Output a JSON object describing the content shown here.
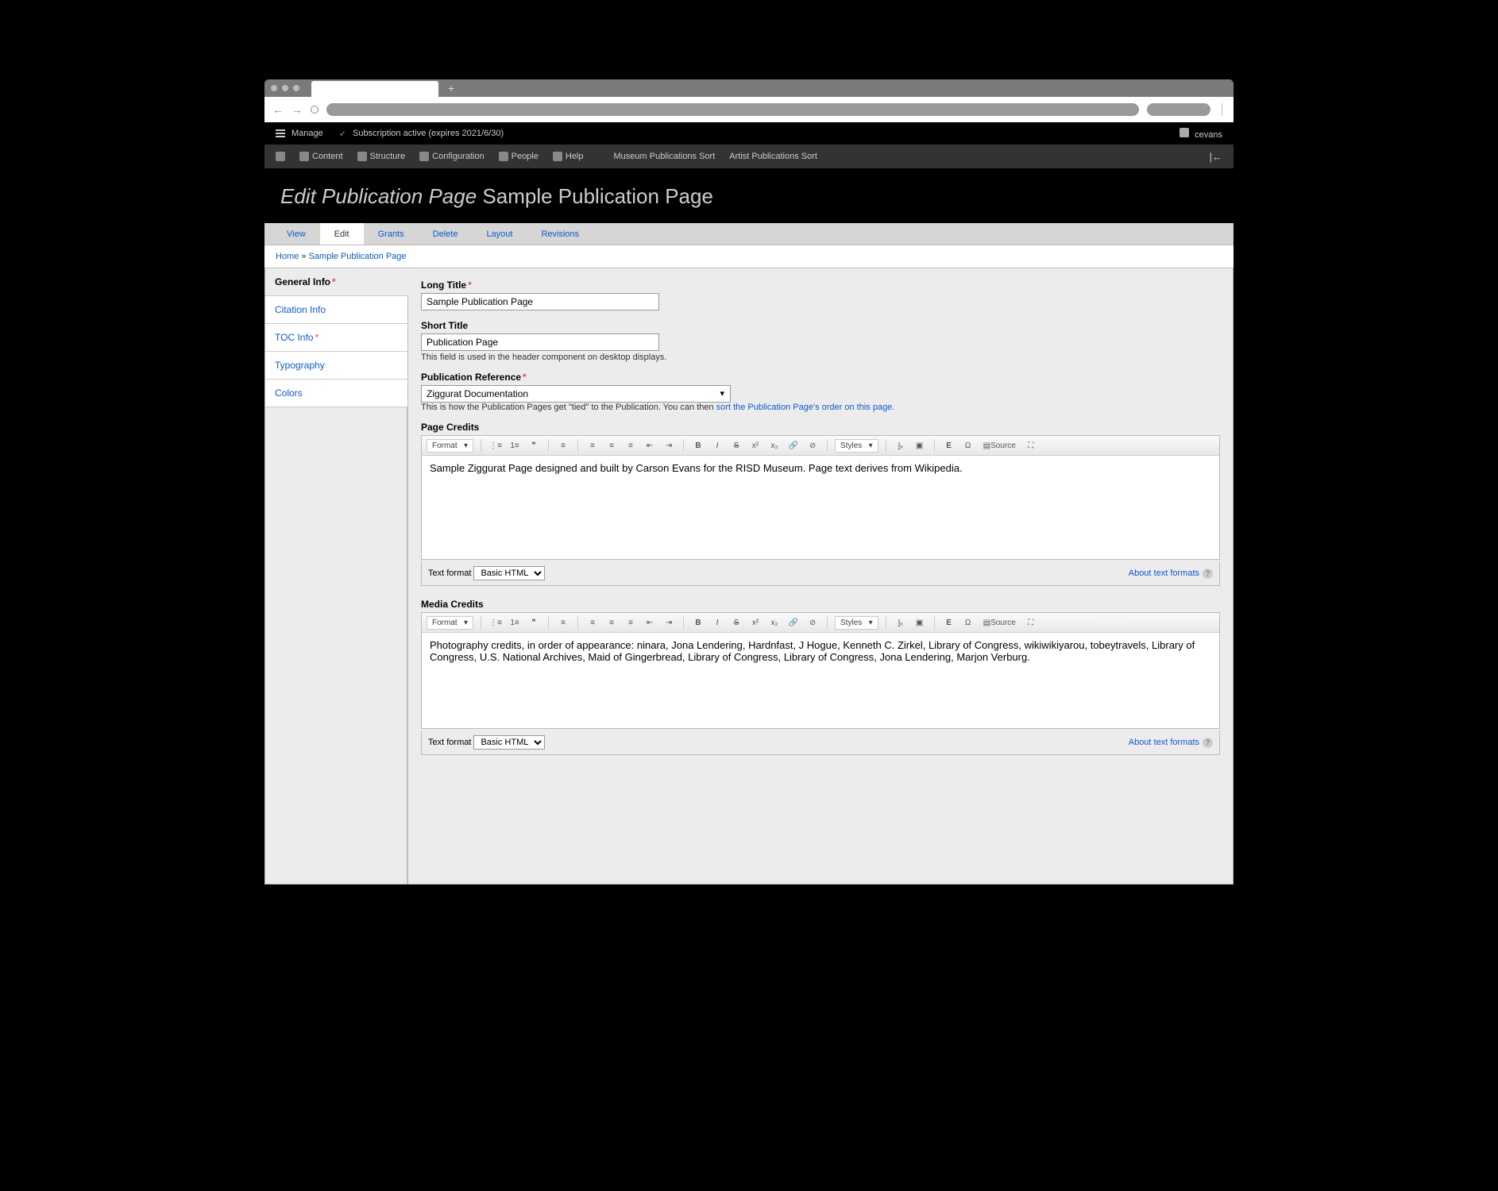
{
  "adminBar1": {
    "manage": "Manage",
    "subscription": "Subscription active (expires 2021/6/30)",
    "user": "cevans"
  },
  "adminBar2": {
    "content": "Content",
    "structure": "Structure",
    "configuration": "Configuration",
    "people": "People",
    "help": "Help",
    "museumSort": "Museum Publications Sort",
    "artistSort": "Artist Publications Sort"
  },
  "pageTitle": {
    "prefix": "Edit Publication Page",
    "name": "Sample Publication Page"
  },
  "localTabs": {
    "view": "View",
    "edit": "Edit",
    "grants": "Grants",
    "delete": "Delete",
    "layout": "Layout",
    "revisions": "Revisions"
  },
  "breadcrumb": {
    "home": "Home",
    "sep": "»",
    "current": "Sample Publication Page"
  },
  "sidebar": {
    "general": "General Info",
    "citation": "Citation Info",
    "toc": "TOC Info",
    "typography": "Typography",
    "colors": "Colors"
  },
  "form": {
    "longTitle": {
      "label": "Long Title",
      "value": "Sample Publication Page"
    },
    "shortTitle": {
      "label": "Short Title",
      "value": "Publication Page",
      "help": "This field is used in the header component on desktop displays."
    },
    "pubRef": {
      "label": "Publication Reference",
      "value": "Ziggurat Documentation",
      "helpPrefix": "This is how the Publication Pages get \"tied\" to the Publication. You can then ",
      "helpLink": "sort the Publication Page's order on this page."
    },
    "pageCredits": {
      "label": "Page Credits",
      "body": "Sample Ziggurat Page designed and built by Carson Evans for the RISD Museum. Page text derives from Wikipedia."
    },
    "mediaCredits": {
      "label": "Media Credits",
      "body": "Photography credits, in order of appearance: ninara, Jona Lendering, Hardnfast, J Hogue, Kenneth C. Zirkel, Library of Congress, wikiwikiyarou, tobeytravels, Library of Congress, U.S. National Archives, Maid of Gingerbread, Library of Congress, Library of Congress, Jona Lendering, Marjon Verburg."
    },
    "textFormatLabel": "Text format",
    "textFormatValue": "Basic HTML",
    "aboutFormats": "About text formats",
    "toolbarFormat": "Format",
    "toolbarStyles": "Styles",
    "toolbarSource": "Source"
  }
}
